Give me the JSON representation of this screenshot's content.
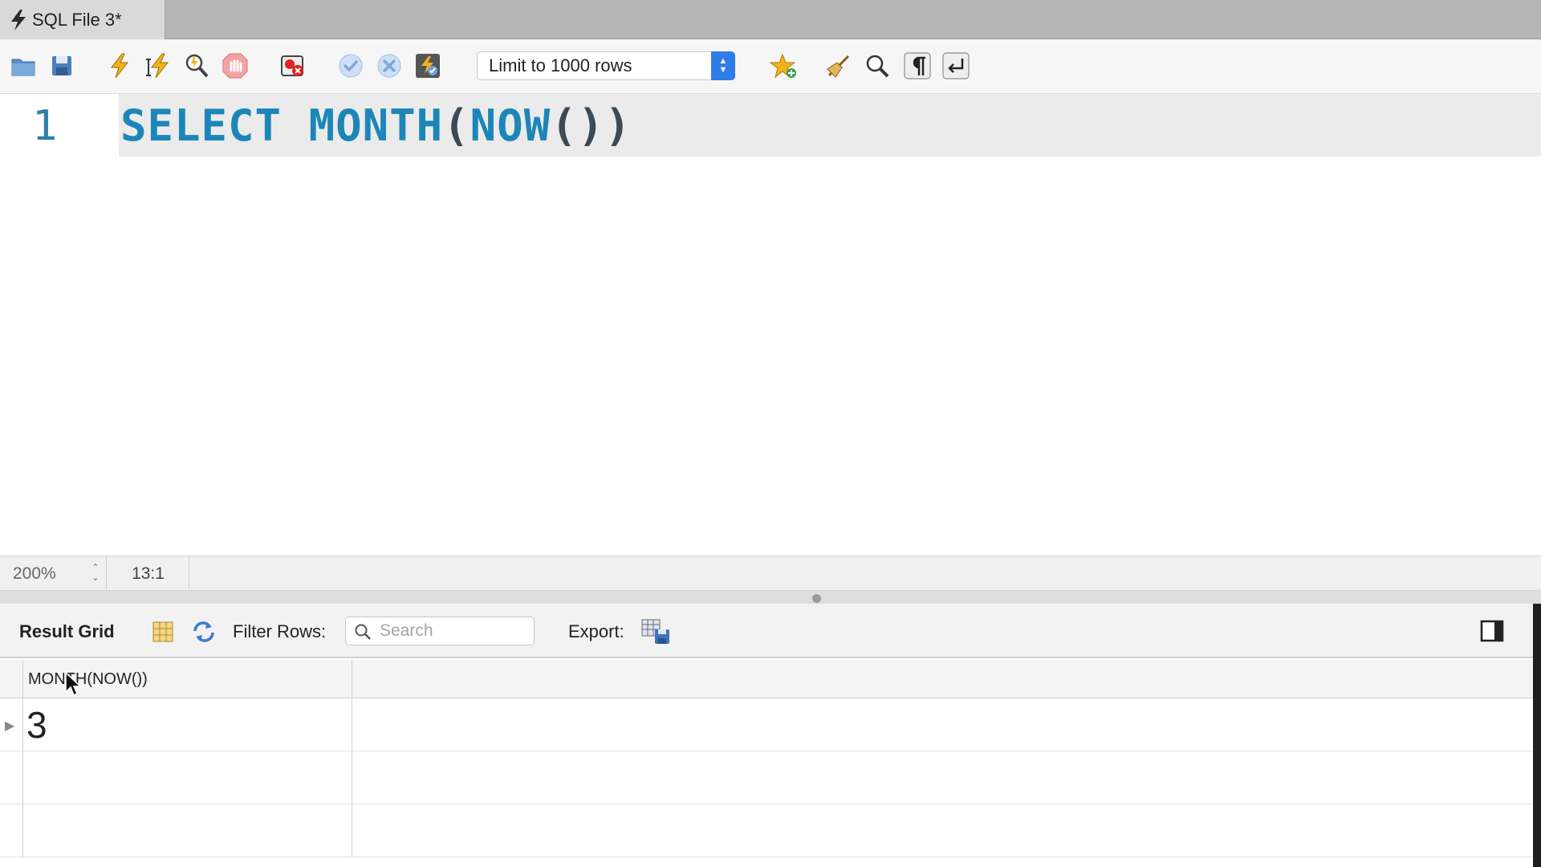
{
  "tab": {
    "title": "SQL File 3*",
    "icon": "lightning-bolt-icon"
  },
  "toolbar": {
    "icons": [
      "open-folder-icon",
      "save-icon",
      "execute-icon",
      "execute-current-icon",
      "explain-icon",
      "stop-icon",
      "toggle-error-stop-icon",
      "commit-icon",
      "rollback-icon",
      "autocommit-icon",
      "add-snippet-icon",
      "beautify-icon",
      "find-icon",
      "invisible-chars-icon",
      "wrap-lines-icon"
    ],
    "limit_label": "Limit to 1000 rows"
  },
  "editor": {
    "line_number": "1",
    "code": {
      "kw1": "SELECT",
      "kw2": "MONTH",
      "p1": "(",
      "kw3": "NOW",
      "p2": "())"
    }
  },
  "statusbar": {
    "zoom": "200%",
    "position": "13:1"
  },
  "results": {
    "result_grid_label": "Result Grid",
    "filter_label": "Filter Rows:",
    "search_placeholder": "Search",
    "export_label": "Export:",
    "column_header": "MONTH(NOW())",
    "rows": [
      {
        "value": "3"
      },
      {
        "value": ""
      },
      {
        "value": ""
      }
    ]
  },
  "colors": {
    "keyword": "#1c86b8",
    "accent": "#2f7ee8",
    "line_number": "#2e7fa8"
  }
}
